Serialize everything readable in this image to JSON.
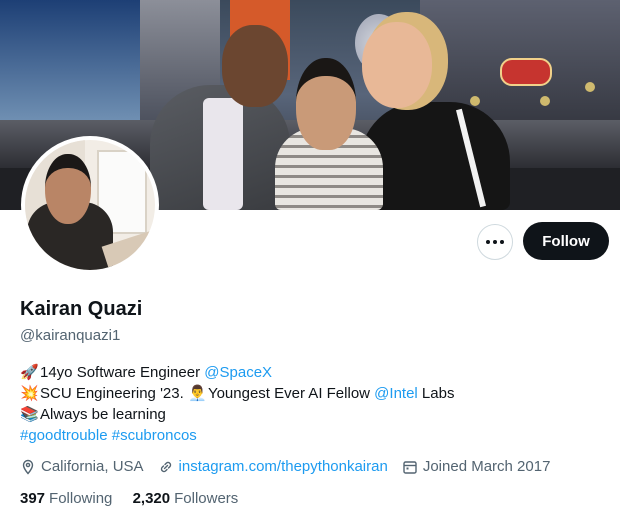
{
  "profile": {
    "name": "Kairan Quazi",
    "handle": "@kairanquazi1"
  },
  "actions": {
    "follow_label": "Follow"
  },
  "bio": {
    "line1": {
      "emoji": "🚀",
      "text": "14yo Software Engineer ",
      "mention": "@SpaceX"
    },
    "line2": {
      "emoji": "💥",
      "text": "SCU Engineering '23. ",
      "emoji2": "👨‍💼",
      "text2": "Youngest Ever AI Fellow ",
      "mention": "@Intel",
      "text3": " Labs"
    },
    "line3": {
      "emoji": "📚",
      "text": "Always be learning"
    },
    "line4": {
      "hashtag1": "#goodtrouble",
      "hashtag2": "#scubroncos"
    }
  },
  "meta": {
    "location": "California, USA",
    "website": "instagram.com/thepythonkairan",
    "joined": "Joined March 2017"
  },
  "counts": {
    "following_num": "397",
    "following_label": "Following",
    "followers_num": "2,320",
    "followers_label": "Followers"
  },
  "colors": {
    "link": "#1d9bf0",
    "text_primary": "#0f1419",
    "text_secondary": "#536471",
    "button_bg": "#0f1419"
  },
  "icons": {
    "more": "ellipsis-icon",
    "location": "location-pin-icon",
    "website": "link-icon",
    "joined": "calendar-icon"
  }
}
